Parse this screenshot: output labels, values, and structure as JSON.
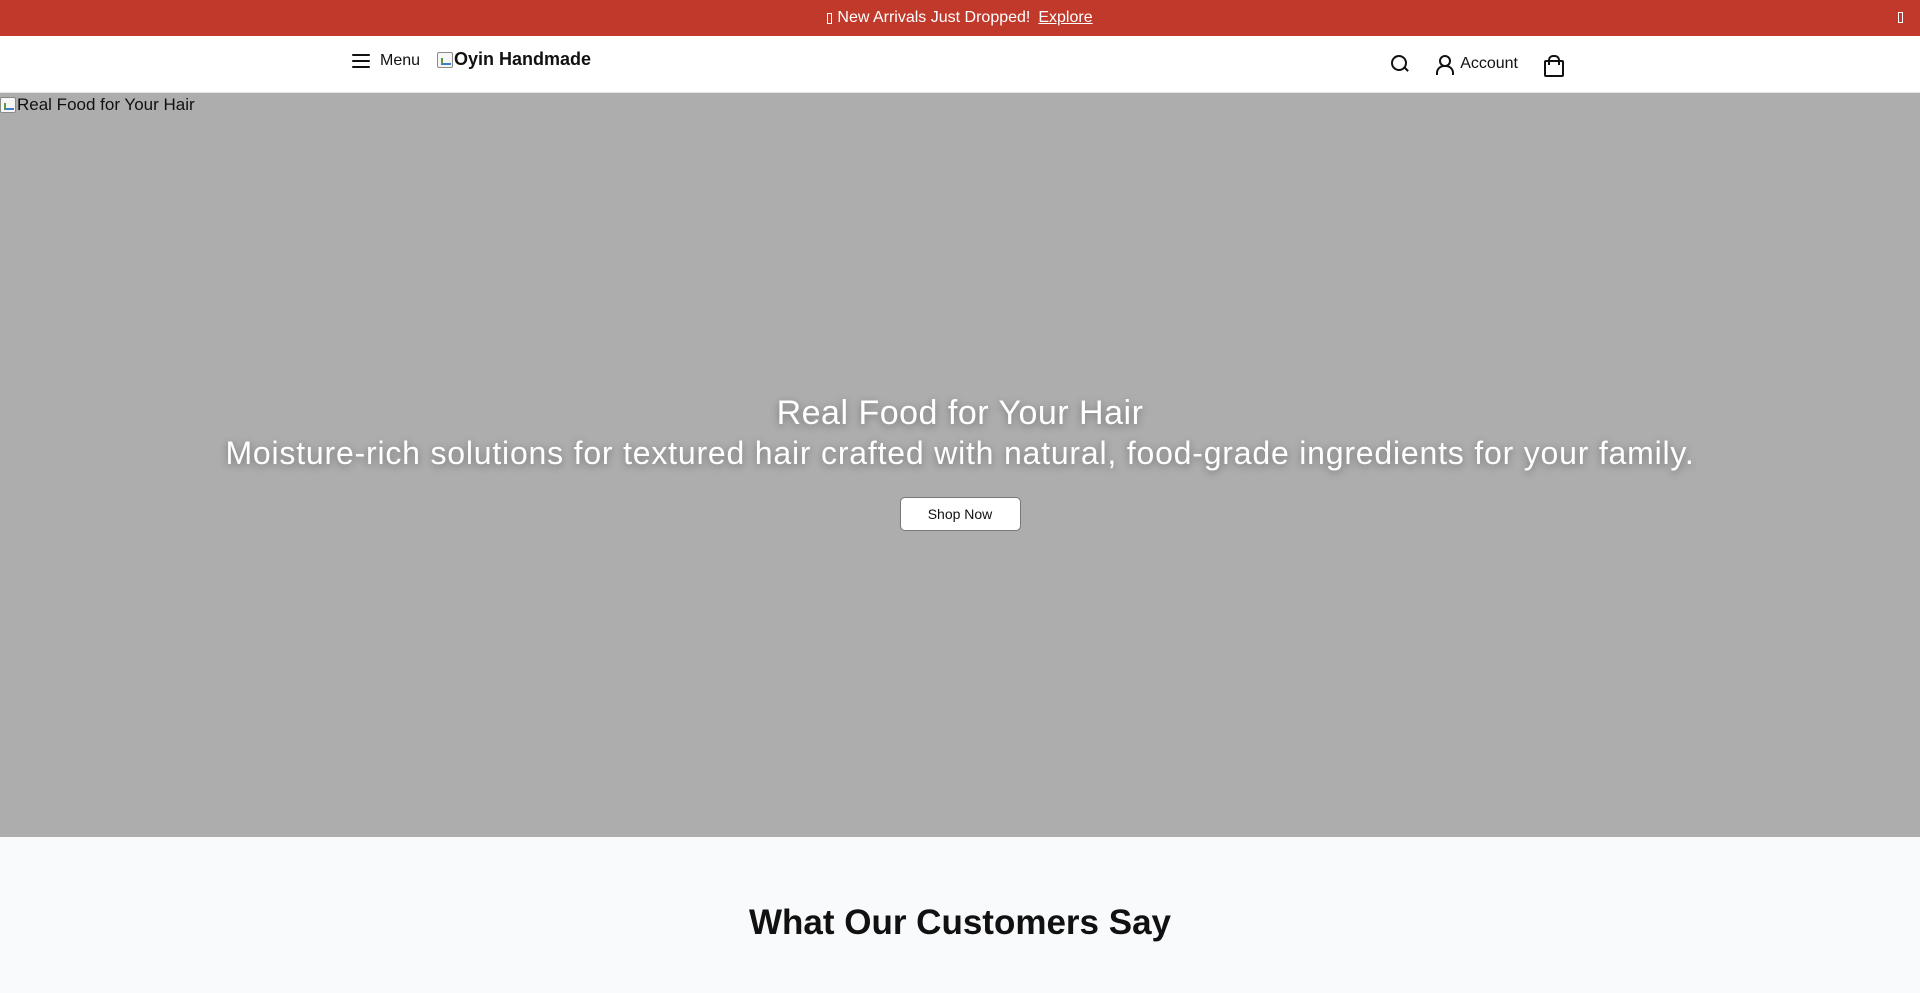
{
  "announcement": {
    "text": "New Arrivals Just Dropped!",
    "link_label": "Explore",
    "background_color": "#c0392b"
  },
  "header": {
    "menu_label": "Menu",
    "logo_alt": "Oyin Handmade",
    "account_label": "Account",
    "icons": [
      "hamburger-icon",
      "search-icon",
      "user-icon",
      "shopping-bag-icon"
    ]
  },
  "hero": {
    "image_alt": "Real Food for Your Hair",
    "title": "Real Food for Your Hair",
    "subtitle": "Moisture-rich solutions for textured hair crafted with natural, food-grade ingredients for your family.",
    "cta_label": "Shop Now"
  },
  "testimonials": {
    "title": "What Our Customers Say"
  }
}
